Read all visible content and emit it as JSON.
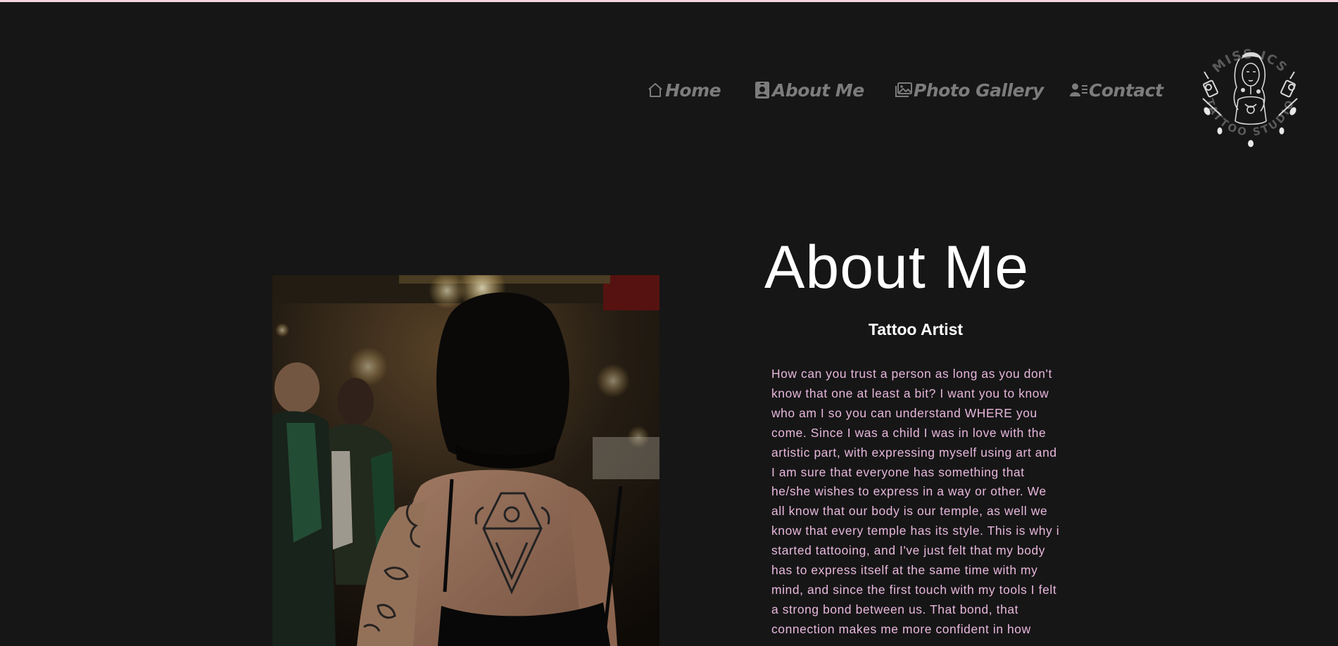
{
  "nav": {
    "items": [
      {
        "label": "Home",
        "icon": "home-icon"
      },
      {
        "label": "About Me",
        "icon": "id-badge-icon"
      },
      {
        "label": "Photo Gallery",
        "icon": "image-icon"
      },
      {
        "label": "Contact",
        "icon": "user-list-icon"
      }
    ]
  },
  "logo": {
    "text_top": "MISS ICS",
    "text_bottom": "TATTOO STUDIO"
  },
  "about": {
    "title": "About Me",
    "subtitle": "Tattoo Artist",
    "bio": "How can you trust a person as long as you don't know that one at least a bit? I want you to know who am I so you can understand WHERE you come. Since I was a child I was in love with the artistic part, with expressing myself using art and I am sure that everyone has something that he/she wishes to express in a way or other. We all know that our body is our temple, as well we know that every temple has its style. This is why i started tattooing, and I've just felt that my body has to express itself at the same time with my mind, and since the first touch with my tools I felt a strong bond between us. That bond, that connection makes me more confident in how"
  },
  "colors": {
    "background": "#161616",
    "nav_text": "#7c7c7c",
    "heading": "#ffffff",
    "body_text": "#e8b8dd",
    "top_border": "#f3d6de"
  }
}
